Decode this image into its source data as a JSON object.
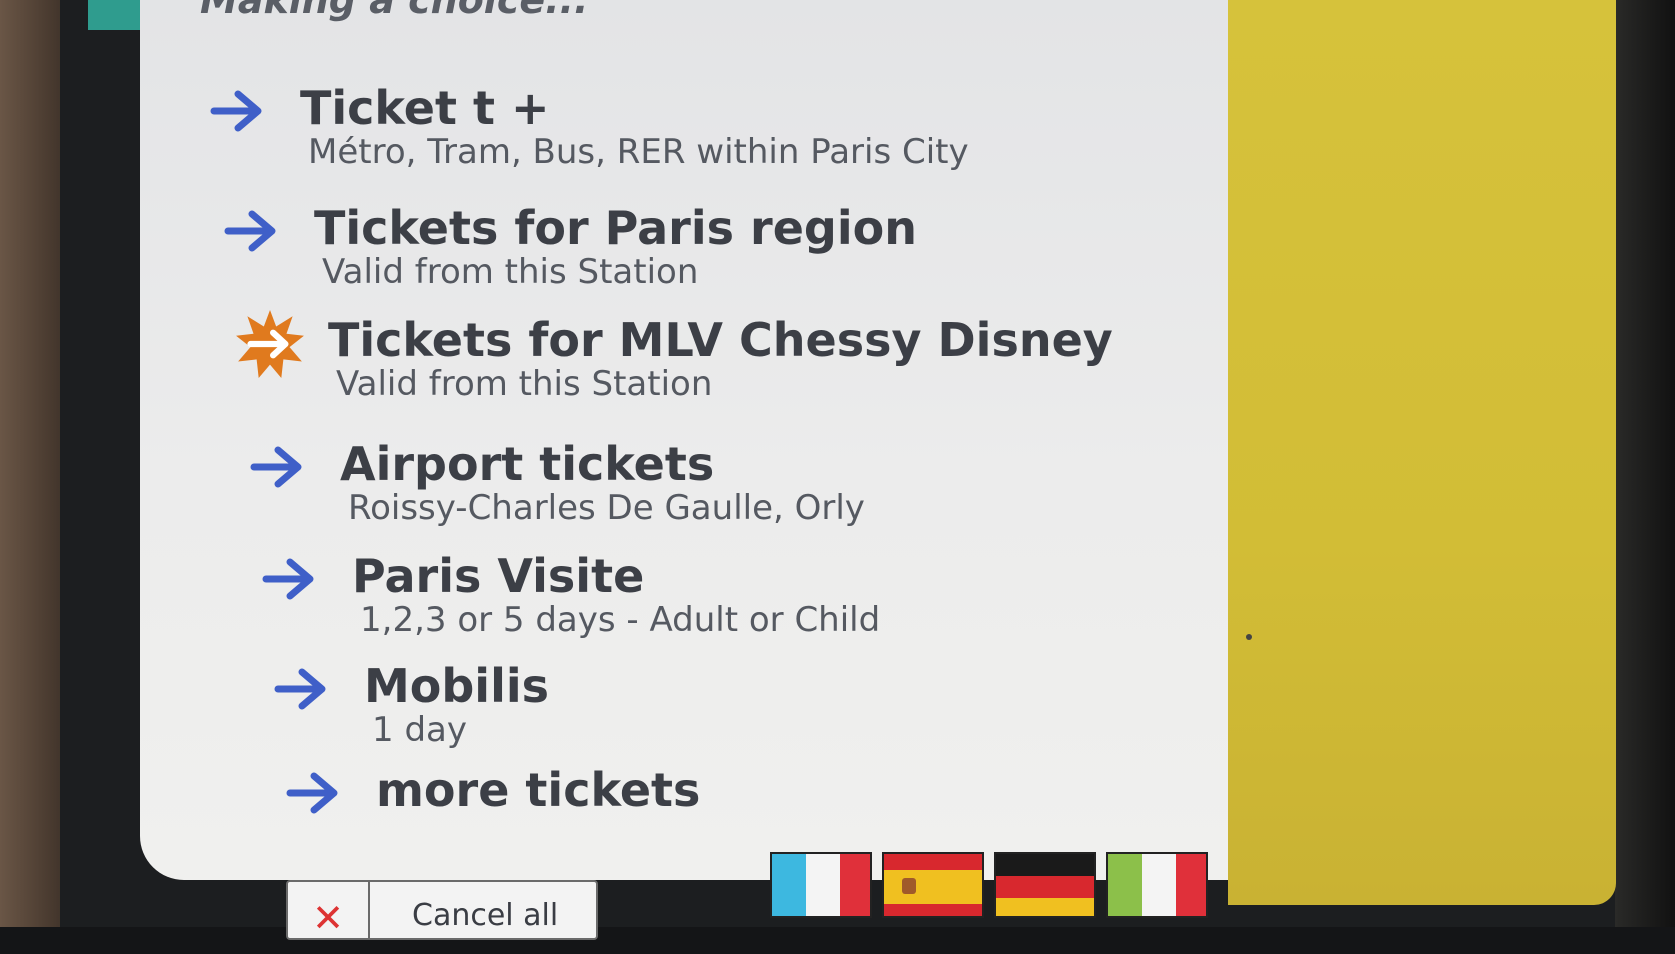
{
  "screen": {
    "header_title": "Making a choice...",
    "menu_items": [
      {
        "title": "Ticket t +",
        "subtitle": "Métro, Tram, Bus, RER within Paris City",
        "icon": "arrow-right-icon"
      },
      {
        "title": "Tickets for Paris region",
        "subtitle": "Valid from this Station",
        "icon": "arrow-right-icon"
      },
      {
        "title": "Tickets for MLV Chessy Disney",
        "subtitle": "Valid from this Station",
        "icon": "starburst-arrow-icon"
      },
      {
        "title": "Airport tickets",
        "subtitle": "Roissy-Charles De Gaulle, Orly",
        "icon": "arrow-right-icon"
      },
      {
        "title": "Paris Visite",
        "subtitle": "1,2,3 or 5 days - Adult or Child",
        "icon": "arrow-right-icon"
      },
      {
        "title": "Mobilis",
        "subtitle": "1 day",
        "icon": "arrow-right-icon"
      },
      {
        "title": "more tickets",
        "subtitle": "",
        "icon": "arrow-right-icon"
      }
    ],
    "cancel_button": {
      "label": "Cancel all",
      "icon": "close-icon"
    },
    "language_flags": [
      "french-flag",
      "spanish-flag",
      "german-flag",
      "italian-flag"
    ]
  },
  "colors": {
    "arrow": "#3f5fc8",
    "starburst": "#e07a1e",
    "screen_bg": "#ececec",
    "yellow_panel": "#d4bf38",
    "title_text": "#3c3f46"
  }
}
